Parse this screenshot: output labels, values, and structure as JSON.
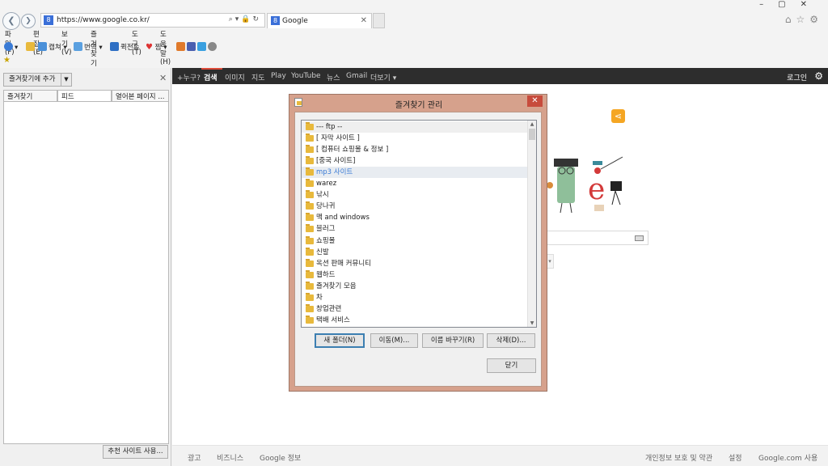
{
  "browser": {
    "address_url": "https://www.google.co.kr/",
    "tab_title": "Google",
    "menu": [
      "파일(F)",
      "편집(E)",
      "보기(V)",
      "즐겨찾기(A)",
      "도구(T)",
      "도움말(H)"
    ],
    "toolbar": {
      "capture": "캡쳐",
      "translate": "번역",
      "transfer": "퀵전송",
      "pick": "찜"
    }
  },
  "favorites_panel": {
    "add_button": "즐겨찾기에 추가",
    "tabs": [
      "즐겨찾기",
      "피드",
      "열어본 페이지 ..."
    ],
    "recommend_button": "추천 사이트 사용..."
  },
  "google": {
    "bar_links": [
      "+누구?",
      "검색",
      "이미지",
      "지도",
      "Play",
      "YouTube",
      "뉴스",
      "Gmail",
      "더보기 ▾"
    ],
    "login": "로그인",
    "footer_left": [
      "광고",
      "비즈니스",
      "Google 정보"
    ],
    "footer_right": [
      "개인정보 보호 및 약관",
      "설정",
      "Google.com 사용"
    ]
  },
  "dialog": {
    "title": "즐겨찾기 관리",
    "close": "✕",
    "folders": [
      "--- ftp --",
      "[ 자막 사이트 ]",
      "[ 컴퓨터 쇼핑몰 & 정보 ]",
      "[중국 사이트]",
      "mp3 사이트",
      "warez",
      "낚시",
      "당나귀",
      "맥 and windows",
      "블러그",
      "쇼핑몰",
      "신발",
      "옥션 판매 커뮤니티",
      "웹하드",
      "즐겨찾기 모음",
      "차",
      "창업관련",
      "택배 서비스"
    ],
    "selected_index": 4,
    "buttons": {
      "new_folder": "새 폴더(N)",
      "move": "이동(M)...",
      "rename": "이름 바꾸기(R)",
      "delete": "삭제(D)...",
      "close": "닫기"
    }
  }
}
